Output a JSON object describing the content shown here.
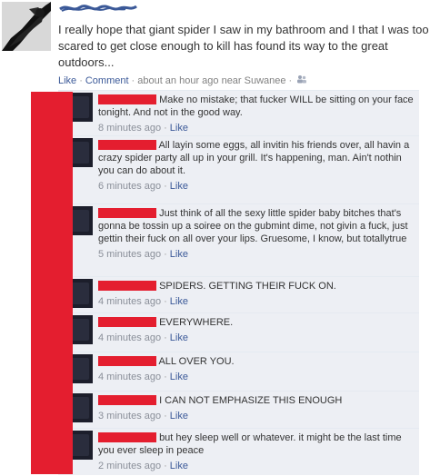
{
  "post": {
    "author_name": "",
    "status_text": "I really hope that giant spider I saw in my bathroom and I that I was too scared to get close enough to kill has found its way to the great outdoors...",
    "meta": {
      "like_label": "Like",
      "comment_label": "Comment",
      "timestamp": "about an hour ago near Suwanee",
      "separator": "·",
      "audience_icon": "friends-people-icon"
    }
  },
  "comments": [
    {
      "author": "",
      "text": "Make no mistake; that fucker WILL be sitting on your face tonight. And not in the good way.",
      "time": "8 minutes ago",
      "like_label": "Like"
    },
    {
      "author": "",
      "text": "All layin some eggs, all invitin his friends over, all havin a crazy spider party all up in your grill. It's happening, man. Ain't nothin you can do about it.",
      "time": "6 minutes ago",
      "like_label": "Like"
    },
    {
      "author": "",
      "text": "Just think of all the sexy little spider baby bitches that's gonna be tossin up a soiree on the gubmint dime, not givin a fuck, just gettin their fuck on all over your lips. Gruesome, I know, but totallytrue",
      "time": "5 minutes ago",
      "like_label": "Like"
    },
    {
      "author": "",
      "text": "SPIDERS. GETTING THEIR FUCK ON.",
      "time": "4 minutes ago",
      "like_label": "Like"
    },
    {
      "author": "",
      "text": "EVERYWHERE.",
      "time": "4 minutes ago",
      "like_label": "Like"
    },
    {
      "author": "",
      "text": "ALL OVER YOU.",
      "time": "4 minutes ago",
      "like_label": "Like"
    },
    {
      "author": "",
      "text": "I CAN NOT EMPHASIZE THIS ENOUGH",
      "time": "3 minutes ago",
      "like_label": "Like"
    },
    {
      "author": "",
      "text": "but hey sleep well or whatever. it might be the last time you ever sleep in peace",
      "time": "2 minutes ago",
      "like_label": "Like"
    }
  ],
  "colors": {
    "link": "#3b5998",
    "comment_background": "#edeff4",
    "redaction": "#e41e2f",
    "muted_text": "#808080"
  }
}
